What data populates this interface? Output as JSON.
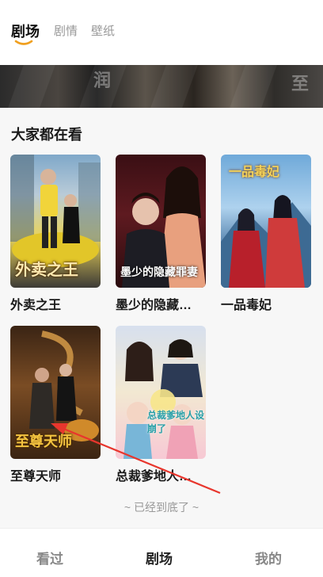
{
  "top_tabs": [
    {
      "label": "剧场",
      "active": true
    },
    {
      "label": "剧情",
      "active": false
    },
    {
      "label": "壁纸",
      "active": false
    }
  ],
  "section": {
    "title": "大家都在看"
  },
  "cards": [
    {
      "title": "外卖之王",
      "poster_text": "外卖之王"
    },
    {
      "title": "墨少的隐藏…",
      "poster_text": "墨少的隐藏罪妻"
    },
    {
      "title": "一品毒妃",
      "poster_text": "一品毒妃"
    },
    {
      "title": "至尊天师",
      "poster_text": "至尊天师"
    },
    {
      "title": "总裁爹地人…",
      "poster_text": "总裁爹地人设崩了"
    }
  ],
  "end_text": "~ 已经到底了 ~",
  "bottom_nav": [
    {
      "label": "看过",
      "active": false
    },
    {
      "label": "剧场",
      "active": true
    },
    {
      "label": "我的",
      "active": false
    }
  ],
  "colors": {
    "accent_orange": "#f0a020",
    "annotation_red": "#e8362d"
  }
}
